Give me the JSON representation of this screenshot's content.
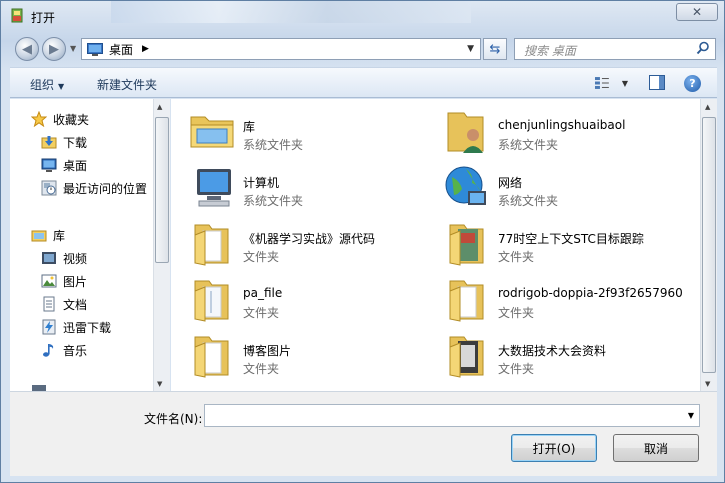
{
  "window": {
    "title": "打开",
    "close_symbol": "✕"
  },
  "nav": {
    "back_icon": "back-arrow-icon",
    "forward_icon": "forward-arrow-icon",
    "address_path": "桌面",
    "search_placeholder": "搜索 桌面"
  },
  "toolbar": {
    "organize_label": "组织",
    "new_folder_label": "新建文件夹",
    "help_symbol": "?"
  },
  "sidebar": {
    "favorites": {
      "label": "收藏夹",
      "icon": "star-icon"
    },
    "favorites_items": [
      {
        "label": "下载",
        "icon": "download-folder-icon"
      },
      {
        "label": "桌面",
        "icon": "desktop-icon"
      },
      {
        "label": "最近访问的位置",
        "icon": "recent-places-icon"
      }
    ],
    "libraries": {
      "label": "库",
      "icon": "library-icon"
    },
    "libraries_items": [
      {
        "label": "视频",
        "icon": "video-library-icon"
      },
      {
        "label": "图片",
        "icon": "pictures-library-icon"
      },
      {
        "label": "文档",
        "icon": "documents-library-icon"
      },
      {
        "label": "迅雷下载",
        "icon": "thunder-download-icon"
      },
      {
        "label": "音乐",
        "icon": "music-library-icon"
      }
    ]
  },
  "items": [
    {
      "name": "库",
      "type": "系统文件夹",
      "icon": "library-folder-icon"
    },
    {
      "name": "chenjunlingshuaibaol",
      "type": "系统文件夹",
      "icon": "user-folder-icon"
    },
    {
      "name": "计算机",
      "type": "系统文件夹",
      "icon": "computer-icon"
    },
    {
      "name": "网络",
      "type": "系统文件夹",
      "icon": "network-icon"
    },
    {
      "name": "《机器学习实战》源代码",
      "type": "文件夹",
      "icon": "folder-icon"
    },
    {
      "name": "77时空上下文STC目标跟踪",
      "type": "文件夹",
      "icon": "folder-icon"
    },
    {
      "name": "pa_file",
      "type": "文件夹",
      "icon": "folder-icon"
    },
    {
      "name": "rodrigob-doppia-2f93f2657960",
      "type": "文件夹",
      "icon": "folder-icon"
    },
    {
      "name": "博客图片",
      "type": "文件夹",
      "icon": "folder-icon"
    },
    {
      "name": "大数据技术大会资料",
      "type": "文件夹",
      "icon": "folder-icon"
    }
  ],
  "footer": {
    "filename_label": "文件名(N):",
    "filename_value": "",
    "open_label": "打开(O)",
    "cancel_label": "取消"
  }
}
